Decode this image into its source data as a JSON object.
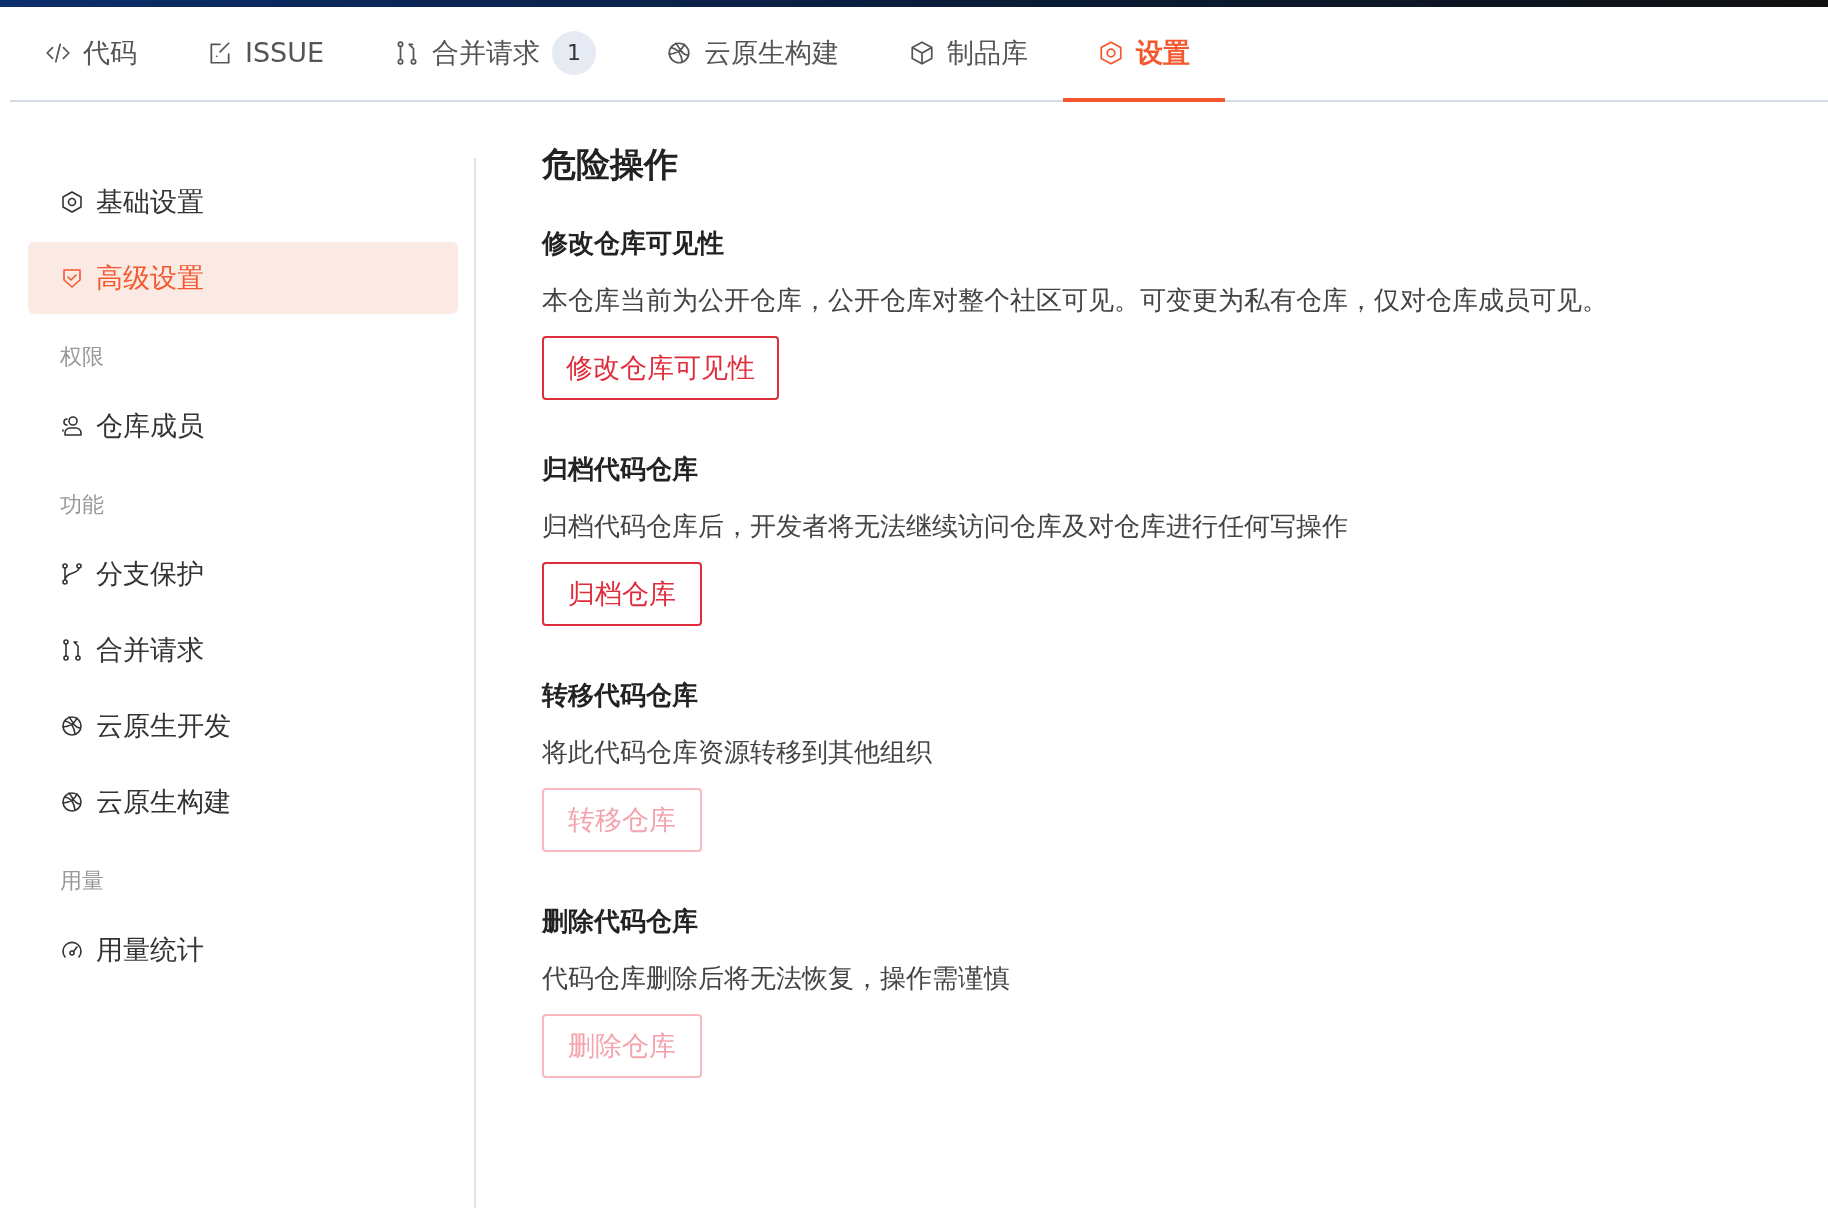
{
  "tabs": [
    {
      "label": "代码",
      "selected": false
    },
    {
      "label": "ISSUE",
      "selected": false
    },
    {
      "label": "合并请求",
      "badge": "1",
      "selected": false
    },
    {
      "label": "云原生构建",
      "selected": false
    },
    {
      "label": "制品库",
      "selected": false
    },
    {
      "label": "设置",
      "selected": true
    }
  ],
  "sidebar": {
    "items": [
      {
        "kind": "item",
        "label": "基础设置",
        "selected": false
      },
      {
        "kind": "item",
        "label": "高级设置",
        "selected": true
      },
      {
        "kind": "group",
        "label": "权限"
      },
      {
        "kind": "item",
        "label": "仓库成员",
        "selected": false
      },
      {
        "kind": "group",
        "label": "功能"
      },
      {
        "kind": "item",
        "label": "分支保护",
        "selected": false
      },
      {
        "kind": "item",
        "label": "合并请求",
        "selected": false
      },
      {
        "kind": "item",
        "label": "云原生开发",
        "selected": false
      },
      {
        "kind": "item",
        "label": "云原生构建",
        "selected": false
      },
      {
        "kind": "group",
        "label": "用量"
      },
      {
        "kind": "item",
        "label": "用量统计",
        "selected": false
      }
    ]
  },
  "content": {
    "title": "危险操作",
    "sections": [
      {
        "title": "修改仓库可见性",
        "description": "本仓库当前为公开仓库，公开仓库对整个社区可见。可变更为私有仓库，仅对仓库成员可见。",
        "button": "修改仓库可见性",
        "disabled": false
      },
      {
        "title": "归档代码仓库",
        "description": "归档代码仓库后，开发者将无法继续访问仓库及对仓库进行任何写操作",
        "button": "归档仓库",
        "disabled": false
      },
      {
        "title": "转移代码仓库",
        "description": "将此代码仓库资源转移到其他组织",
        "button": "转移仓库",
        "disabled": true
      },
      {
        "title": "删除代码仓库",
        "description": "代码仓库删除后将无法恢复，操作需谨慎",
        "button": "删除仓库",
        "disabled": true
      }
    ]
  }
}
